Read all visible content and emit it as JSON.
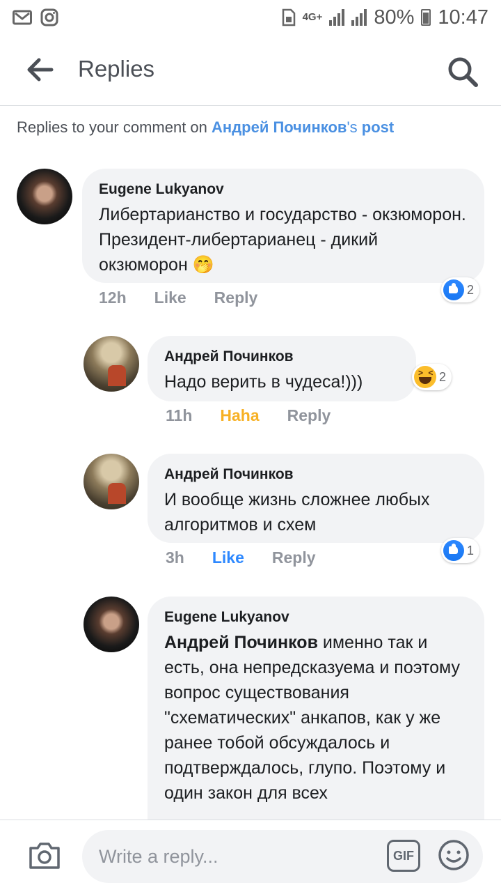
{
  "statusbar": {
    "net_top": "4G+",
    "battery": "80%",
    "time": "10:47",
    "icons": [
      "gmail-icon",
      "instagram-icon",
      "sim-icon",
      "signal-icon",
      "battery-icon"
    ]
  },
  "header": {
    "title": "Replies"
  },
  "subtitle": {
    "prefix": "Replies to your comment on ",
    "author": "Андрей Починков",
    "suffix": "'s ",
    "post": "post"
  },
  "comments": [
    {
      "author": "Eugene Lukyanov",
      "text": "Либертарианство и государство - окзюморон. Президент-либертарианец - дикий окзюморон 🤭",
      "time": "12h",
      "like_label": "Like",
      "reply_label": "Reply",
      "reaction": "like",
      "reaction_count": "2"
    },
    {
      "author": "Андрей Починков",
      "text": "Надо верить в чудеса!)))",
      "time": "11h",
      "like_label": "Haha",
      "reply_label": "Reply",
      "reaction": "haha",
      "reaction_count": "2"
    },
    {
      "author": "Андрей Починков",
      "text": "И вообще жизнь сложнее любых алгоритмов и схем",
      "time": "3h",
      "like_label": "Like",
      "reply_label": "Reply",
      "reaction": "like",
      "reaction_count": "1"
    },
    {
      "author": "Eugene Lukyanov",
      "tag": "Андрей Починков",
      "text": " именно так и есть, она непредсказуема и поэтому вопрос существования \"схематических\" анкапов, как у же ранее тобой обсуждалось и подтверждалось, глупо. Поэтому и один закон для всех"
    }
  ],
  "composer": {
    "placeholder": "Write a reply...",
    "gif_label": "GIF"
  },
  "colors": {
    "link": "#4a90e2",
    "like": "#2d88ff",
    "haha": "#f7b125",
    "bubble": "#f2f3f5"
  }
}
